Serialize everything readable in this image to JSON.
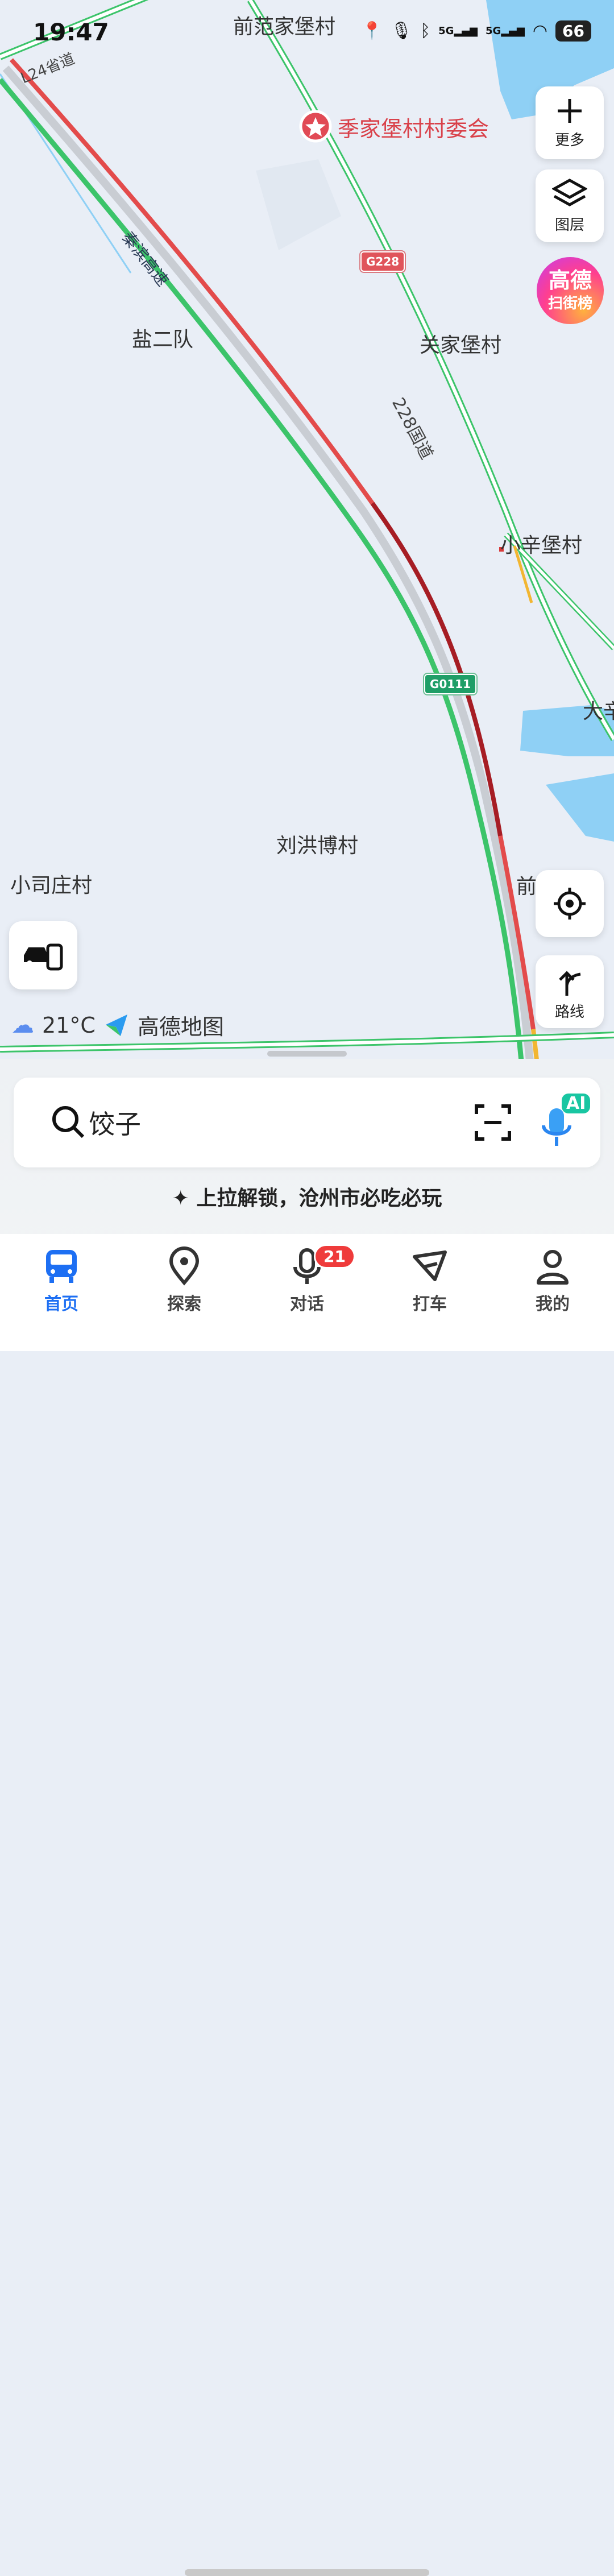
{
  "status_bar": {
    "time": "19:47",
    "signal_1": "5G",
    "signal_2": "5G",
    "battery": "66"
  },
  "map_labels": {
    "qianfan": "前范家堡村",
    "yanerdui": "盐二队",
    "guanjia": "关家堡村",
    "guodao": "228国道",
    "xiaoxin": "小辛堡村",
    "da": "大辛",
    "liuhongbo": "刘洪博村",
    "xiaosi": "小司庄村",
    "qian2": "前",
    "qinbin": "秦滨高速",
    "l24": "L24省道"
  },
  "poi": {
    "name": "季家堡村村委会"
  },
  "shields": {
    "g228": "G228",
    "g0111": "G0111"
  },
  "right_controls": {
    "more": "更多",
    "layers": "图层",
    "rank_line1": "高德",
    "rank_line2": "扫街榜",
    "route": "路线"
  },
  "weather": {
    "temp": "21°C",
    "brand": "高德地图"
  },
  "search": {
    "value": "饺子",
    "ai_badge": "AI"
  },
  "tip": "上拉解锁，沧州市必吃必玩",
  "nav": {
    "items": [
      {
        "label": "首页"
      },
      {
        "label": "探索"
      },
      {
        "label": "对话",
        "badge": "21"
      },
      {
        "label": "打车"
      },
      {
        "label": "我的"
      }
    ]
  },
  "colors": {
    "accent": "#1d6ff3",
    "traffic_red": "#e34b4b",
    "traffic_darkred": "#a61d24",
    "traffic_green": "#3cc46a",
    "traffic_yellow": "#f2b632",
    "water": "#8fd0f5"
  }
}
